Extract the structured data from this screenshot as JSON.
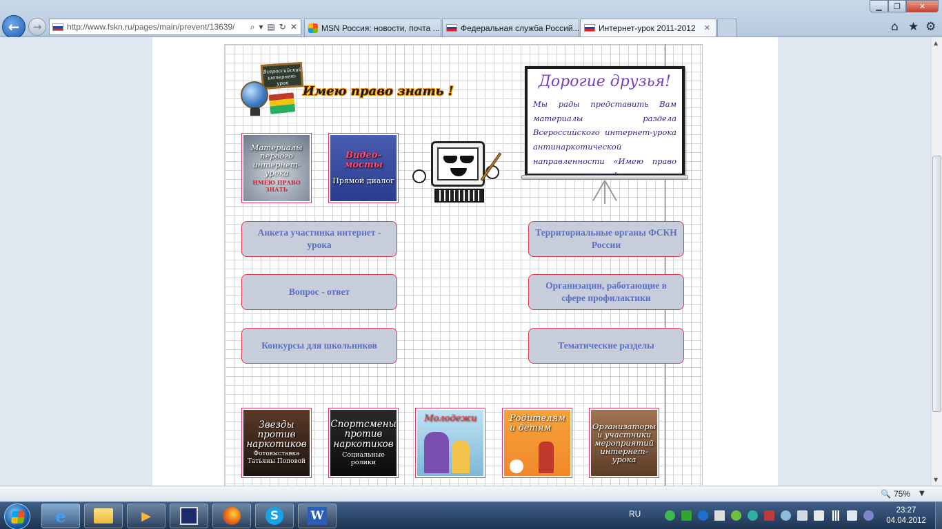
{
  "browser": {
    "address": "http://www.fskn.ru/pages/main/prevent/13639/",
    "tabs": [
      {
        "label": "MSN Россия: новости, почта ..."
      },
      {
        "label": "Федеральная служба Россий..."
      },
      {
        "label": "Интернет-урок 2011-2012"
      }
    ],
    "zoom": "75%"
  },
  "page": {
    "logo": {
      "chalkboard": "Всероссийский интернет-урок",
      "title": "Имею право знать !"
    },
    "top_thumbs": [
      {
        "title": "Материалы первого интернет-урока",
        "sub": "ИМЕЮ ПРАВО ЗНАТЬ"
      },
      {
        "title": "Видео-мосты",
        "sub": "Прямой диалог"
      }
    ],
    "board": {
      "title": "Дорогие друзья!",
      "text": "Мы рады представить Вам материалы раздела Всероссийского интернет-урока антинаркотической направленности «Имею право знать!»"
    },
    "menu": {
      "questionnaire": "Анкета участника интернет - урока",
      "qa": "Вопрос - ответ",
      "contests": "Конкурсы для школьников",
      "territorial": "Территориальные органы ФСКН России",
      "organizations": "Организации, работающие в сфере профилактики",
      "thematic": "Тематические разделы"
    },
    "bottom_thumbs": [
      {
        "title": "Звезды против наркотиков",
        "sub": "Фотовыставка Татьяны Поповой"
      },
      {
        "title": "Спортсмены против наркотиков",
        "sub": "Социальные ролики"
      },
      {
        "title": "Молодежи",
        "sub": ""
      },
      {
        "title": "Родителям и детям",
        "sub": ""
      },
      {
        "title": "Организаторы и участники мероприятий интернет-урока",
        "sub": ""
      }
    ]
  },
  "taskbar": {
    "lang": "RU",
    "time": "23:27",
    "date": "04.04.2012"
  }
}
